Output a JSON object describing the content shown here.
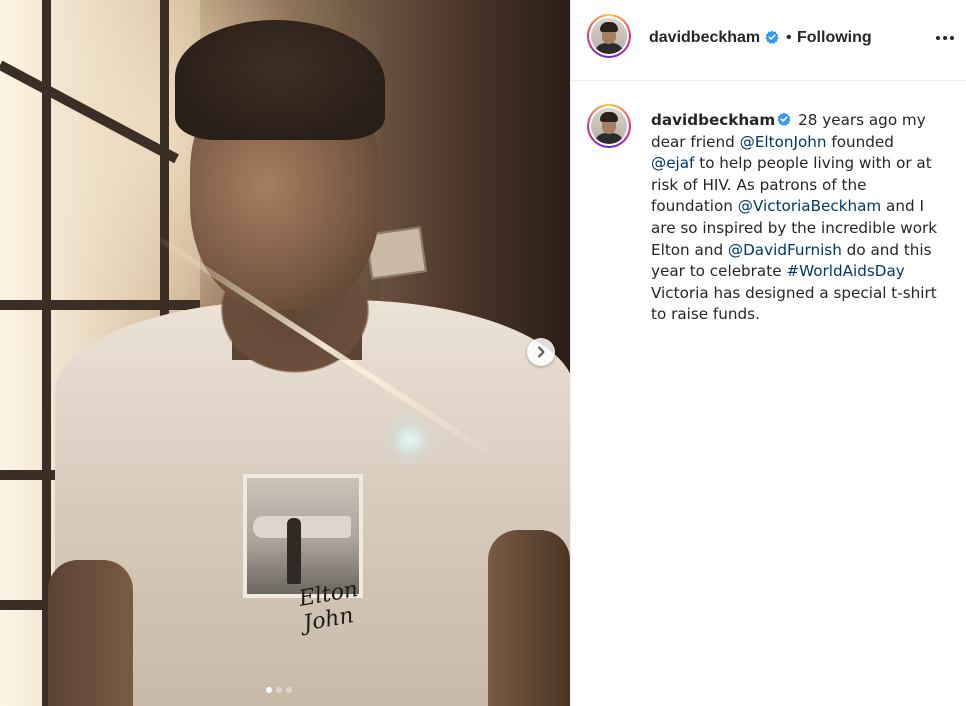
{
  "post": {
    "username": "davidbeckham",
    "follow_separator": "•",
    "follow_status": "Following",
    "more_label": "More options",
    "carousel": {
      "total": 3,
      "current": 1,
      "next_label": "Next",
      "signature_text": "Elton John"
    },
    "caption": {
      "username": "davidbeckham",
      "seg1": " 28 years ago my dear friend ",
      "mention1": "@EltonJohn",
      "seg2": " founded ",
      "mention2": "@ejaf",
      "seg3": " to help people living with or at risk of HIV. As patrons of the foundation ",
      "mention3": "@VictoriaBeckham",
      "seg4": " and I are so inspired by the incredible work Elton and ",
      "mention4": "@DavidFurnish",
      "seg5": " do and this year to celebrate ",
      "hashtag1": "#WorldAidsDay",
      "seg6": " Victoria has designed a special t-shirt to raise funds."
    }
  },
  "colors": {
    "verified_blue": "#3897f0",
    "link_blue": "#00376b",
    "text": "#262626"
  },
  "icons": {
    "verified": "verified-badge-icon",
    "next": "chevron-right-icon",
    "more": "ellipsis-icon"
  }
}
